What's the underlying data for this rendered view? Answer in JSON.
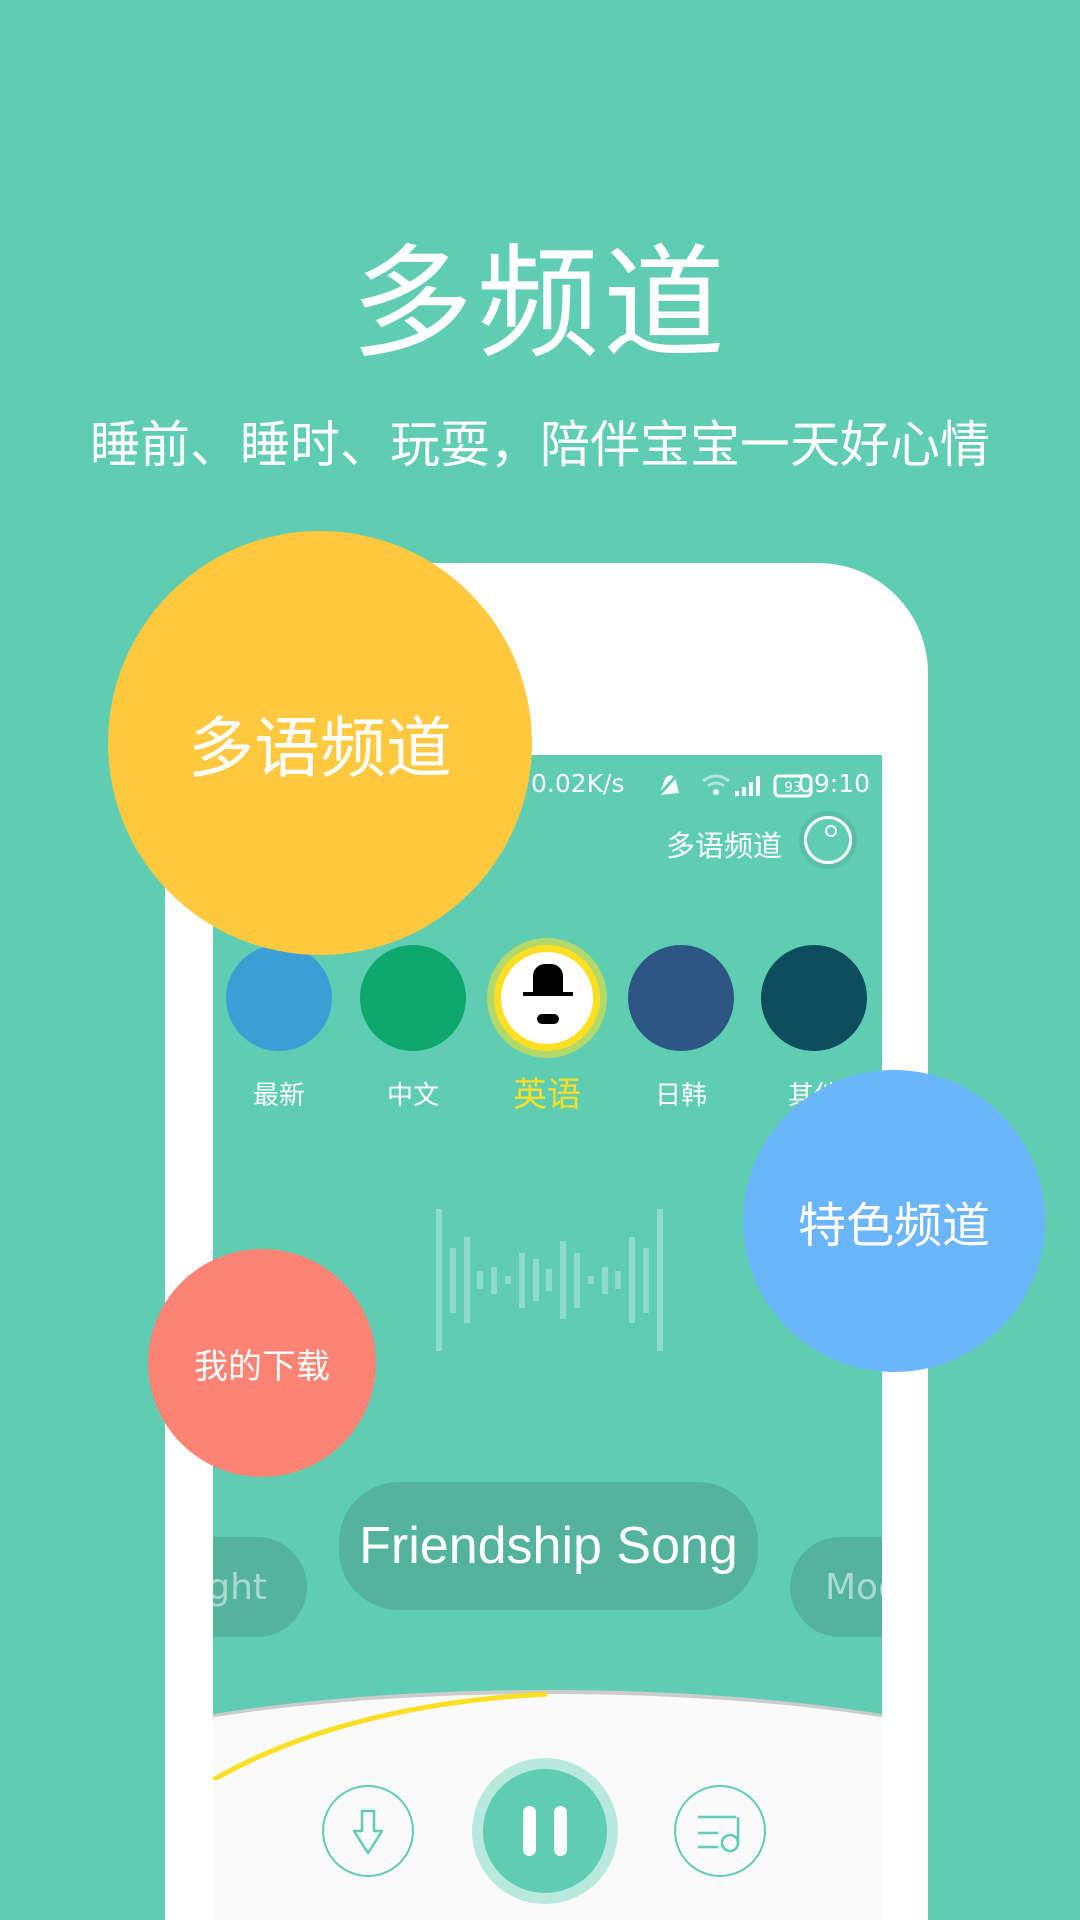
{
  "header": {
    "title": "多频道",
    "subtitle": "睡前、睡时、玩耍，陪伴宝宝一天好心情"
  },
  "status_bar": {
    "net_speed": "0.02K/s",
    "battery": "93",
    "time": "09:10"
  },
  "app": {
    "channel_title": "多语频道"
  },
  "channels": [
    {
      "label": "最新",
      "icon": "campfire-icon"
    },
    {
      "label": "中文",
      "icon": "tiananmen-flag-icon"
    },
    {
      "label": "英语",
      "icon": "gentleman-hat-icon",
      "selected": true
    },
    {
      "label": "日韩",
      "icon": "mount-fuji-icon"
    },
    {
      "label": "其他",
      "icon": "frog-icon"
    }
  ],
  "songs": {
    "prev": "Night",
    "current": "Friendship Song",
    "next": "Moon"
  },
  "player": {
    "progress_percent": 50
  },
  "bubbles": {
    "multilang": "多语频道",
    "special": "特色频道",
    "downloads": "我的下载"
  },
  "colors": {
    "background": "#5fcdb2",
    "selected": "#fcdf22",
    "yellow_bubble": "#fec83f",
    "blue_bubble": "#6bb5fc",
    "red_bubble": "#fd8474"
  }
}
